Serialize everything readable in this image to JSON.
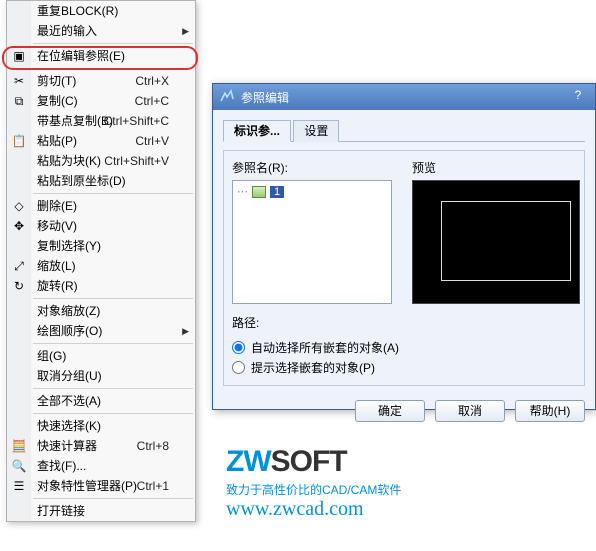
{
  "menu": {
    "items": [
      {
        "label": "重复BLOCK(R)"
      },
      {
        "label": "最近的输入",
        "arrow": true
      },
      {
        "sep": true
      },
      {
        "label": "在位编辑参照(E)",
        "icon": "refedit-icon",
        "hl": true
      },
      {
        "sep": true
      },
      {
        "label": "剪切(T)",
        "sc": "Ctrl+X",
        "icon": "scissors-icon"
      },
      {
        "label": "复制(C)",
        "sc": "Ctrl+C",
        "icon": "copy-icon"
      },
      {
        "label": "带基点复制(B)",
        "sc": "Ctrl+Shift+C"
      },
      {
        "label": "粘贴(P)",
        "sc": "Ctrl+V",
        "icon": "paste-icon"
      },
      {
        "label": "粘贴为块(K)",
        "sc": "Ctrl+Shift+V"
      },
      {
        "label": "粘贴到原坐标(D)"
      },
      {
        "sep": true
      },
      {
        "label": "删除(E)",
        "icon": "eraser-icon"
      },
      {
        "label": "移动(V)",
        "icon": "move-icon"
      },
      {
        "label": "复制选择(Y)"
      },
      {
        "label": "缩放(L)",
        "icon": "scale-icon"
      },
      {
        "label": "旋转(R)",
        "icon": "rotate-icon"
      },
      {
        "sep": true
      },
      {
        "label": "对象缩放(Z)"
      },
      {
        "label": "绘图顺序(O)",
        "arrow": true
      },
      {
        "sep": true
      },
      {
        "label": "组(G)"
      },
      {
        "label": "取消分组(U)"
      },
      {
        "sep": true
      },
      {
        "label": "全部不选(A)"
      },
      {
        "sep": true
      },
      {
        "label": "快速选择(K)"
      },
      {
        "label": "快速计算器",
        "sc": "Ctrl+8",
        "icon": "calc-icon"
      },
      {
        "label": "查找(F)...",
        "icon": "find-icon"
      },
      {
        "label": "对象特性管理器(P)",
        "sc": "Ctrl+1",
        "icon": "props-icon"
      },
      {
        "sep": true
      },
      {
        "label": "打开链接"
      }
    ]
  },
  "dialog": {
    "title": "参照编辑",
    "tabs": [
      "标识参...",
      "设置"
    ],
    "refname_label": "参照名(R):",
    "preview_label": "预览",
    "tree_node": "1",
    "path_label": "路径:",
    "radio1": "自动选择所有嵌套的对象(A)",
    "radio2": "提示选择嵌套的对象(P)",
    "ok": "确定",
    "cancel": "取消",
    "help": "帮助(H)"
  },
  "logo": {
    "brand_zw": "ZW",
    "brand_soft": "SOFT",
    "tagline": "致力于高性价比的CAD/CAM软件",
    "url": "www.zwcad.com"
  }
}
